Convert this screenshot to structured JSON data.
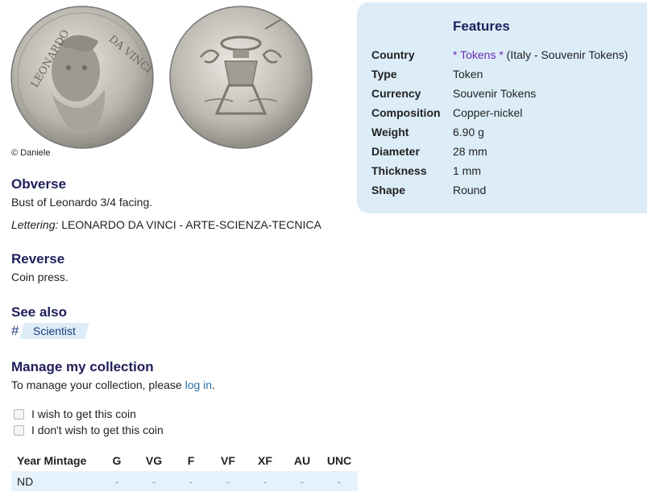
{
  "credit": "© Daniele",
  "obverse": {
    "title": "Obverse",
    "description": "Bust of Leonardo 3/4 facing.",
    "lettering_label": "Lettering:",
    "lettering_value": "LEONARDO DA VINCI - ARTE-SCIENZA-TECNICA"
  },
  "reverse": {
    "title": "Reverse",
    "description": "Coin press."
  },
  "see_also": {
    "title": "See also",
    "hash": "#",
    "tag": "Scientist"
  },
  "manage": {
    "title": "Manage my collection",
    "text_before": "To manage your collection, please ",
    "link": "log in",
    "text_after": ".",
    "wish": "I wish to get this coin",
    "not_wish": "I don't wish to get this coin"
  },
  "mintage": {
    "headers": [
      "Year Mintage",
      "G",
      "VG",
      "F",
      "VF",
      "XF",
      "AU",
      "UNC"
    ],
    "rows": [
      [
        "ND",
        "-",
        "-",
        "-",
        "-",
        "-",
        "-",
        "-"
      ]
    ]
  },
  "features": {
    "title": "Features",
    "country_label": "Country",
    "country_link": "* Tokens *",
    "country_rest": " (Italy - Souvenir Tokens)",
    "type_label": "Type",
    "type_value": "Token",
    "currency_label": "Currency",
    "currency_value": "Souvenir Tokens",
    "composition_label": "Composition",
    "composition_value": "Copper-nickel",
    "weight_label": "Weight",
    "weight_value": "6.90 g",
    "diameter_label": "Diameter",
    "diameter_value": "28 mm",
    "thickness_label": "Thickness",
    "thickness_value": "1 mm",
    "shape_label": "Shape",
    "shape_value": "Round"
  },
  "colors": {
    "heading": "#1e1e5a",
    "link": "#2a6fa8",
    "panel": "#dcedf8"
  },
  "icons": [
    "coin-obverse-image",
    "coin-reverse-image",
    "checkbox"
  ]
}
